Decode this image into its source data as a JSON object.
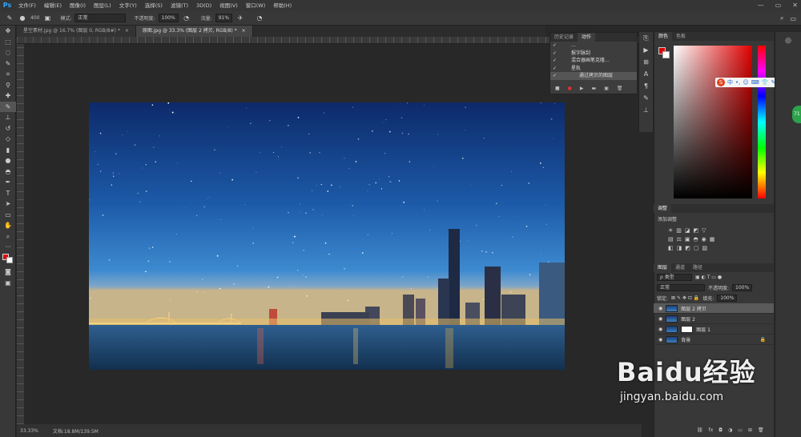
{
  "app": {
    "logo": "Ps"
  },
  "menu": [
    "文件(F)",
    "编辑(E)",
    "图像(I)",
    "图层(L)",
    "文字(Y)",
    "选择(S)",
    "滤镜(T)",
    "3D(D)",
    "视图(V)",
    "窗口(W)",
    "帮助(H)"
  ],
  "window_controls": [
    "—",
    "▭",
    "✕"
  ],
  "options": {
    "brush_size": "400",
    "mode_label": "模式:",
    "mode_value": "正常",
    "opacity_label": "不透明度:",
    "opacity_value": "100%",
    "flow_label": "流量:",
    "flow_value": "91%"
  },
  "tabs": [
    {
      "label": "星空素材.jpg @ 16.7% (图层 0, RGB/8#) *",
      "close": "×"
    },
    {
      "label": "原图.jpg @ 33.3% (图层 2 拷贝, RGB/8) *",
      "close": "×"
    }
  ],
  "status": {
    "zoom": "33.33%",
    "doc": "文档:18.8M/139.5M"
  },
  "history_panel": {
    "tabs": [
      "历史记录",
      "动作"
    ],
    "rows": [
      {
        "check": "✓",
        "label": "...",
        "selected": false
      },
      {
        "check": "✓",
        "label": "报字脉刮",
        "selected": false
      },
      {
        "check": "✓",
        "label": "混合器画笔克隆...",
        "selected": false
      },
      {
        "check": "✓",
        "label": "星轨",
        "selected": false
      },
      {
        "check": "✓",
        "label": "通过拷贝的图层",
        "selected": true
      }
    ],
    "buttons": [
      "■",
      "●",
      "▶",
      "▬",
      "▣",
      "🗑"
    ]
  },
  "color_panel": {
    "tabs": [
      "颜色",
      "色板"
    ],
    "foreground": "#e00000",
    "background": "#ffffff"
  },
  "adjust_panel": {
    "tabs": [
      "调整"
    ],
    "heading": "添加调整",
    "row1": [
      "☀",
      "▥",
      "◪",
      "◩",
      "▽"
    ],
    "row2": [
      "▤",
      "⚖",
      "▣",
      "◓",
      "◉",
      "▦"
    ],
    "row3": [
      "◧",
      "◨",
      "◩",
      "▢",
      "▧"
    ]
  },
  "layers_panel": {
    "tabs": [
      "图层",
      "通道",
      "路径"
    ],
    "filter": "ρ 类型",
    "blend_mode": "正常",
    "opacity_label": "不透明度:",
    "opacity_value": "100%",
    "lock_label": "锁定:",
    "fill_label": "填充:",
    "fill_value": "100%",
    "layers": [
      {
        "name": "图层 2 拷贝",
        "selected": true,
        "mask": false
      },
      {
        "name": "图层 2",
        "selected": false,
        "mask": false
      },
      {
        "name": "图层 1",
        "selected": false,
        "mask": true
      },
      {
        "name": "背景",
        "selected": false,
        "mask": false
      }
    ],
    "footer": [
      "⛓",
      "fx",
      "◘",
      "◑",
      "▭",
      "⊞",
      "🗑"
    ]
  },
  "sogou_bar": {
    "logo": "S",
    "items": [
      "中",
      "•,",
      "☺",
      "⌨",
      "👕",
      "✎",
      "⚙"
    ]
  },
  "green_badge": "71",
  "watermark": {
    "brand": "Baidu经验",
    "url": "jingyan.baidu.com"
  }
}
